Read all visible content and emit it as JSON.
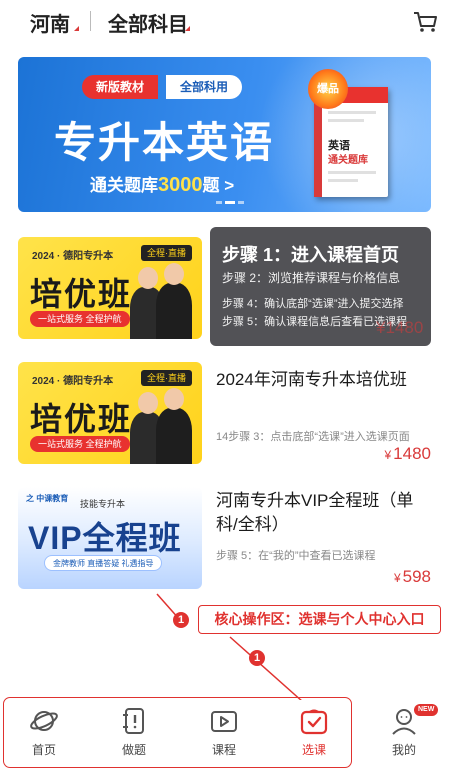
{
  "header": {
    "region": "河南",
    "subject": "全部科目",
    "cart_icon": "cart-icon"
  },
  "banner": {
    "tag_left": "新版教材",
    "tag_right": "全部科用",
    "title": "专升本英语",
    "subtitle_prefix": "通关题库",
    "subtitle_number": "3000",
    "subtitle_suffix": "题 >",
    "badge": "爆品",
    "book_title": "英语",
    "book_sub": "通关题库"
  },
  "steps_overlay": {
    "step1": "步骤 1：进入课程首页",
    "step2": "步骤 2：浏览推荐课程与价格信息",
    "step4": "步骤 4：确认底部“选课”进入提交选择",
    "step5": "步骤 5：确认课程信息后查看已选课程"
  },
  "courses": [
    {
      "thumb_top": "2024 · 德阳专升本",
      "thumb_title": "培优班",
      "thumb_ribbon": "一站式服务 全程护航",
      "thumb_badge": "全程·直播",
      "title": "",
      "desc": "",
      "price": "1480"
    },
    {
      "thumb_top": "2024 · 德阳专升本",
      "thumb_title": "培优班",
      "thumb_ribbon": "一站式服务 全程护航",
      "thumb_badge": "全程·直播",
      "title": "2024年河南专升本培优班",
      "desc": "14步骤 3：点击底部“选课”进入选课页面",
      "price": "1480"
    },
    {
      "thumb_logo": "之 中课教育",
      "thumb_top": "技能专升本",
      "thumb_title": "VIP全程班",
      "thumb_ribbon": "金牌教师 直播答疑 礼遇指导",
      "title": "河南专升本VIP全程班（单科/全科）",
      "desc": "步骤 5：在“我的”中查看已选课程",
      "price": "598"
    }
  ],
  "callout": {
    "number": "1",
    "text": "核心操作区：选课与个人中心入口"
  },
  "nav": {
    "items": [
      {
        "label": "首页",
        "icon": "planet-icon"
      },
      {
        "label": "做题",
        "icon": "notebook-icon"
      },
      {
        "label": "课程",
        "icon": "play-icon"
      },
      {
        "label": "选课",
        "icon": "select-course-icon",
        "active": true
      },
      {
        "label": "我的",
        "icon": "user-icon",
        "badge": "NEW"
      }
    ]
  },
  "currency": "¥",
  "colors": {
    "accent": "#e0322f",
    "price": "#d93a3a",
    "banner": "#2a80e4",
    "thumb_yellow": "#ffd21a"
  }
}
